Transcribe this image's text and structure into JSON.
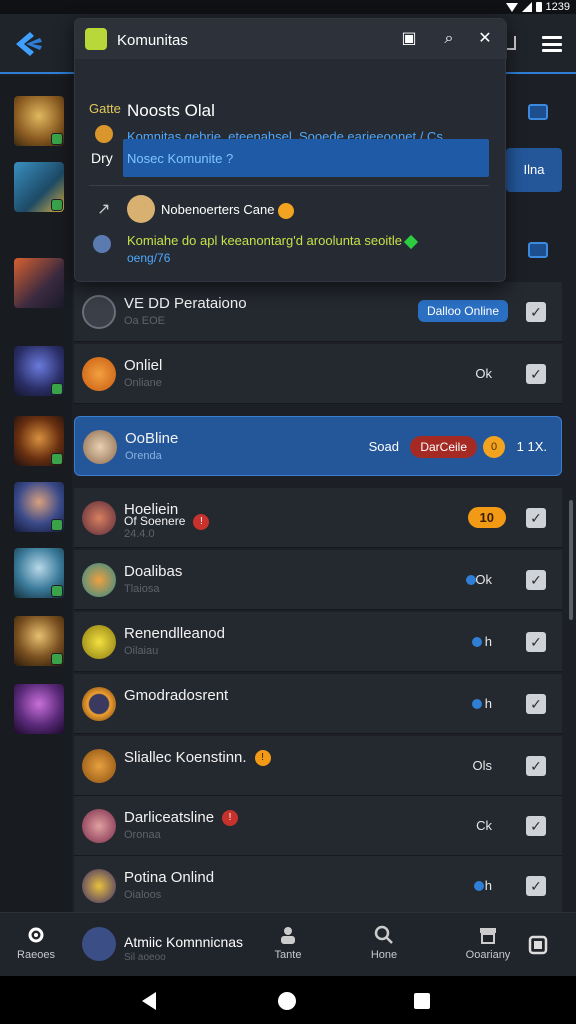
{
  "status_bar": {
    "time": "1239"
  },
  "popup": {
    "title": "Komunitas",
    "post_title": "Noosts Olal",
    "side_label_top": "Gatte",
    "side_label_bottom": "Dry",
    "body_line1": "Komnitas gebrie, eteenahsel, Sooede earieeoonet / Cs.",
    "body_line2": "Nosec Komunite ?",
    "nav_name": "Nobenoerters Cane",
    "message_line1": "Komiahe do apl keeanontarg'd aroolunta seoitle",
    "message_line2": "oeng/76"
  },
  "peek": {
    "button_label": "Ilna",
    "date_hint": "m"
  },
  "rows": [
    {
      "name": "VE DD Perataiono",
      "sub": "Oa EOE",
      "action": "Dalloo Online"
    },
    {
      "name": "Onliel",
      "sub": "Onliane",
      "status": "Ok"
    },
    {
      "name": "OoBline",
      "sub": "Orenda",
      "amount": "Soad",
      "pill": "DarCeile",
      "coin": "0",
      "tail": "1 1X."
    },
    {
      "name": "Hoeliein",
      "name2": "Of Soenere",
      "sub": "24.4.0",
      "pill": "10"
    },
    {
      "name": "Doalibas",
      "sub": "Tlaiosa",
      "status": "Ok"
    },
    {
      "name": "Renendlleanod",
      "sub": "Oilaiau",
      "status": "h"
    },
    {
      "name": "Gmodradosrent",
      "sub": "",
      "status": "h"
    },
    {
      "name": "Sliallec Koenstinn.",
      "sub": "",
      "status": "Ols"
    },
    {
      "name": "Darliceatsline",
      "sub": "Oronaa",
      "status": "Ck"
    },
    {
      "name": "Potina Onlind",
      "sub": "Oialoos",
      "status": "h"
    }
  ],
  "bottom_nav": {
    "tab1": "Raeoes",
    "current_name": "Atmiic Komnnicnas",
    "current_sub": "Sil aoeoo",
    "tab2": "Tante",
    "tab3": "Hone",
    "tab4": "Ooariany"
  },
  "colors": {
    "accent": "#2f7fd6",
    "selected_row": "#24579a",
    "orange": "#f29a16",
    "red": "#a52a23"
  }
}
